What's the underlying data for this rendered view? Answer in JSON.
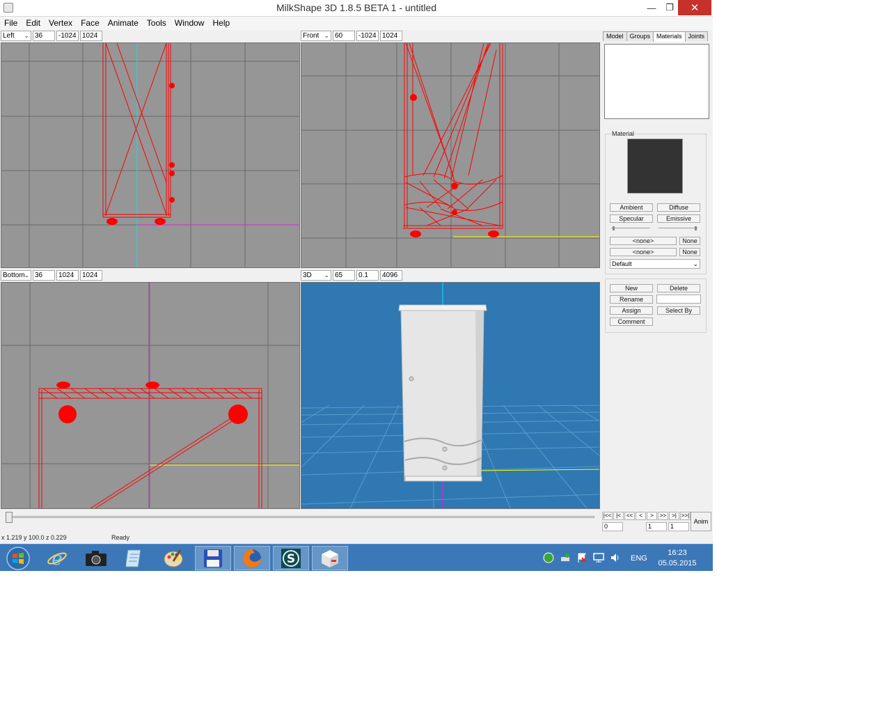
{
  "window": {
    "title": "MilkShape 3D 1.8.5 BETA 1 - untitled",
    "min_glyph": "—",
    "max_glyph": "❐",
    "close_glyph": "✕"
  },
  "menu": [
    "File",
    "Edit",
    "Vertex",
    "Face",
    "Animate",
    "Tools",
    "Window",
    "Help"
  ],
  "viewports": {
    "left": {
      "view": "Left",
      "f1": "36",
      "f2": "-1024",
      "f3": "1024"
    },
    "front": {
      "view": "Front",
      "f1": "60",
      "f2": "-1024",
      "f3": "1024"
    },
    "bottom": {
      "view": "Bottom",
      "f1": "36",
      "f2": "1024",
      "f3": "1024"
    },
    "perspective": {
      "view": "3D",
      "f1": "65",
      "f2": "0.1",
      "f3": "4096"
    }
  },
  "tabs": [
    "Model",
    "Groups",
    "Materials",
    "Joints"
  ],
  "materials": {
    "group_label": "Material",
    "ambient": "Ambient",
    "diffuse": "Diffuse",
    "specular": "Specular",
    "emissive": "Emissive",
    "tex1": "<none>",
    "tex1_none": "None",
    "tex2": "<none>",
    "tex2_none": "None",
    "mode": "Default",
    "new": "New",
    "delete": "Delete",
    "rename": "Rename",
    "assign": "Assign",
    "select_by": "Select By",
    "comment": "Comment"
  },
  "animation": {
    "buttons": [
      "|<<",
      "|<",
      "<<",
      "<",
      ">",
      ">>",
      ">|",
      ">>|"
    ],
    "frame": "0",
    "start": "1",
    "end": "1",
    "anim_label": "Anim"
  },
  "status": {
    "coords": "x 1.219 y 100.0 z 0.229",
    "ready": "Ready"
  },
  "taskbar": {
    "apps": [
      "start",
      "internet-explorer",
      "camera",
      "notepad",
      "paint",
      "floppy-save",
      "firefox",
      "3ds-max",
      "milkshape"
    ],
    "lang": "ENG",
    "time": "16:23",
    "date": "05.05.2015"
  },
  "colors": {
    "viewport_bg": "#969696",
    "perspective_bg": "#2f78b2",
    "wire": "#ff0000",
    "axis_cyan": "#00e5ff",
    "axis_magenta": "#e020e0",
    "axis_yellow": "#ffff00",
    "swatch": "#333333"
  }
}
